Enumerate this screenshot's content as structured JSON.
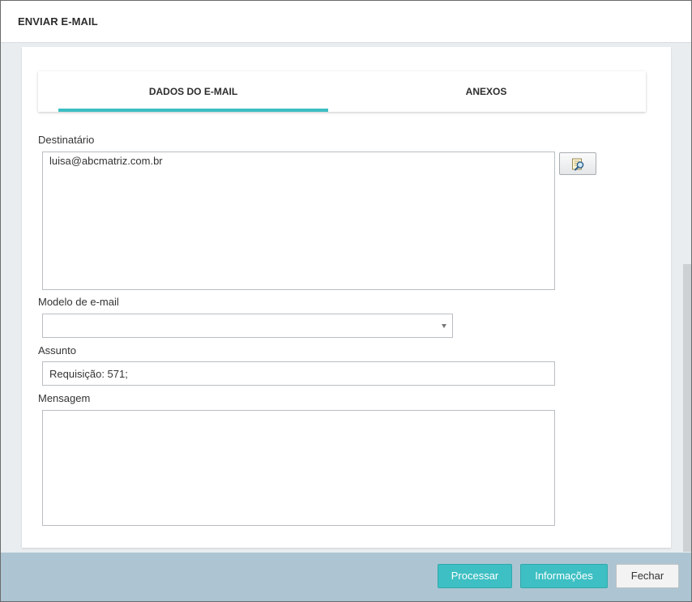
{
  "dialog": {
    "title": "ENVIAR E-MAIL"
  },
  "tabs": [
    {
      "label": "DADOS DO E-MAIL",
      "active": true
    },
    {
      "label": "ANEXOS",
      "active": false
    }
  ],
  "form": {
    "recipient_label": "Destinatário",
    "recipient_value": "luisa@abcmatriz.com.br",
    "lookup_icon": "search-contacts-icon",
    "template_label": "Modelo de e-mail",
    "template_value": "",
    "subject_label": "Assunto",
    "subject_value": "Requisição: 571;",
    "message_label": "Mensagem",
    "message_value": ""
  },
  "footer": {
    "process_label": "Processar",
    "info_label": "Informações",
    "close_label": "Fechar"
  },
  "colors": {
    "accent": "#3dbfc3",
    "footer_bg": "#adc5d2",
    "page_bg": "#e9edef"
  }
}
